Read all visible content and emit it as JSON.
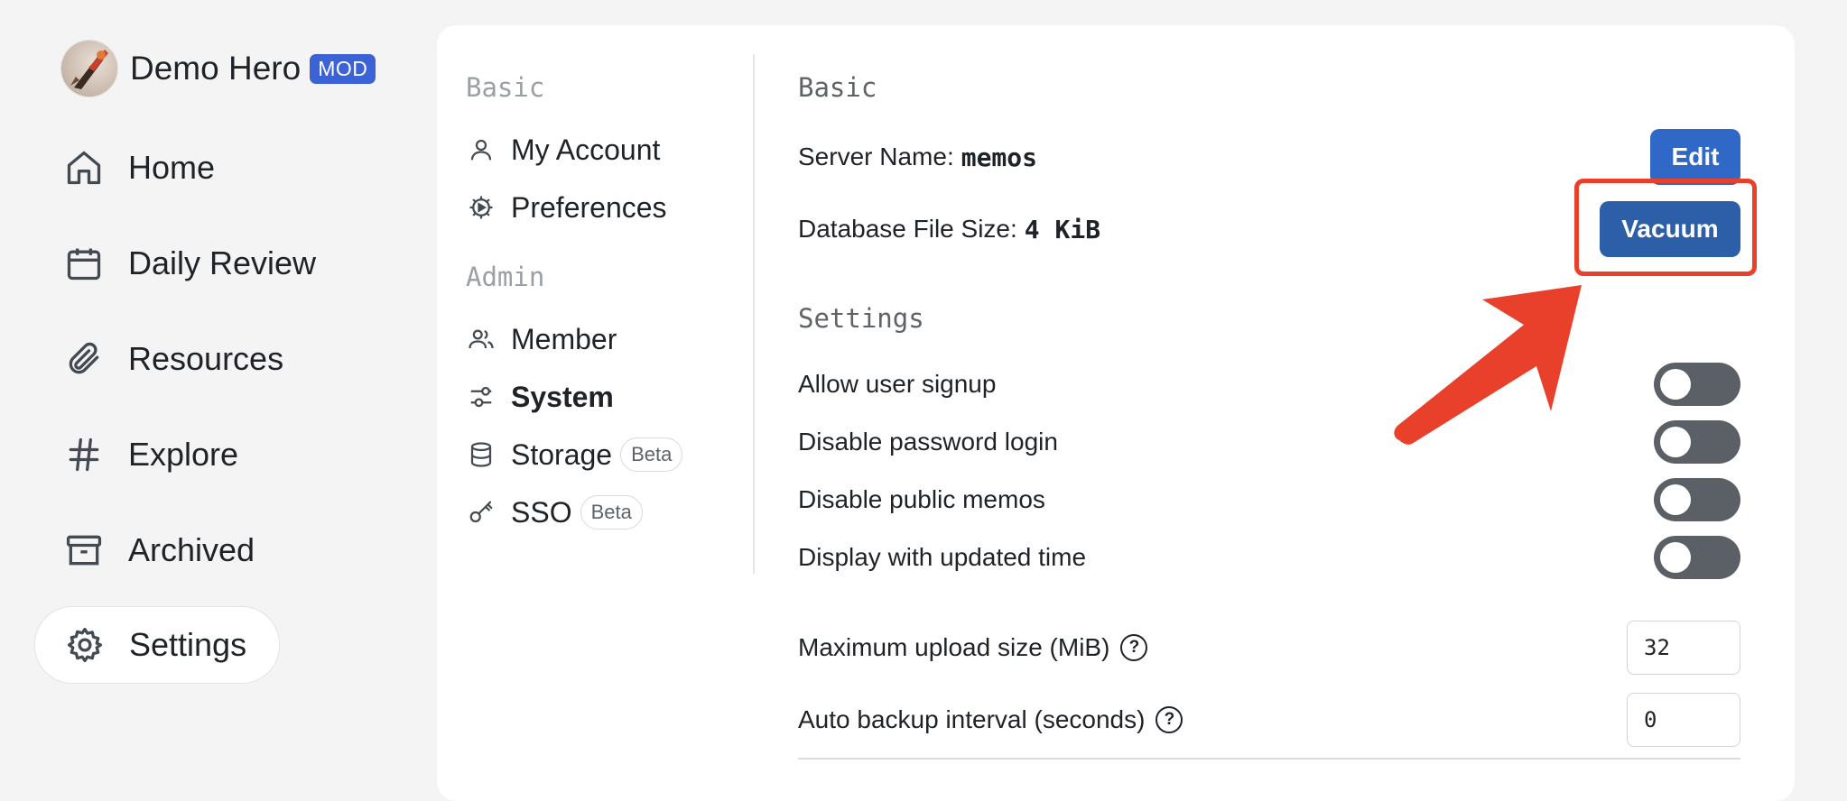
{
  "profile": {
    "name": "Demo Hero",
    "badge": "MOD"
  },
  "nav": [
    {
      "label": "Home",
      "icon": "home-icon"
    },
    {
      "label": "Daily Review",
      "icon": "calendar-icon"
    },
    {
      "label": "Resources",
      "icon": "paperclip-icon"
    },
    {
      "label": "Explore",
      "icon": "hash-icon"
    },
    {
      "label": "Archived",
      "icon": "archive-icon"
    },
    {
      "label": "Settings",
      "icon": "gear-icon",
      "active": true
    }
  ],
  "subnav": {
    "basic_label": "Basic",
    "admin_label": "Admin",
    "items": [
      {
        "label": "My Account",
        "icon": "user-icon"
      },
      {
        "label": "Preferences",
        "icon": "preferences-gear-icon"
      },
      {
        "label": "Member",
        "icon": "users-icon"
      },
      {
        "label": "System",
        "icon": "sliders-icon",
        "active": true
      },
      {
        "label": "Storage",
        "icon": "database-icon",
        "badge": "Beta"
      },
      {
        "label": "SSO",
        "icon": "key-icon",
        "badge": "Beta"
      }
    ]
  },
  "content": {
    "basic_title": "Basic",
    "server_name_label": "Server Name:",
    "server_name_value": "memos",
    "edit_button": "Edit",
    "db_size_label": "Database File Size:",
    "db_size_value": "4 KiB",
    "vacuum_button": "Vacuum",
    "settings_title": "Settings",
    "toggles": [
      {
        "label": "Allow user signup",
        "on": false
      },
      {
        "label": "Disable password login",
        "on": false
      },
      {
        "label": "Disable public memos",
        "on": false
      },
      {
        "label": "Display with updated time",
        "on": false
      }
    ],
    "max_upload_label": "Maximum upload size (MiB)",
    "max_upload_value": "32",
    "backup_label": "Auto backup interval (seconds)",
    "backup_value": "0",
    "help_glyph": "?"
  },
  "colors": {
    "accent": "#2f68c6",
    "annotation": "#e8402a",
    "toggle_off": "#5b6067"
  }
}
